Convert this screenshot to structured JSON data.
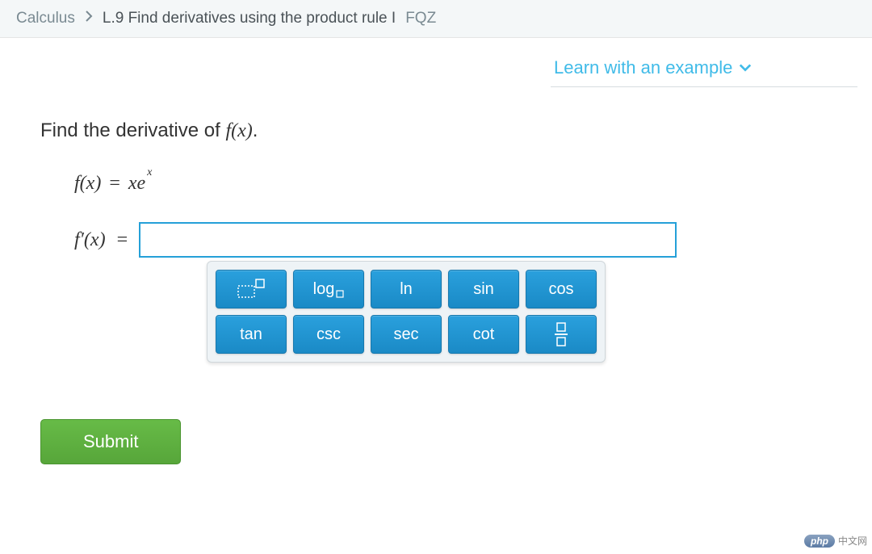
{
  "breadcrumb": {
    "subject": "Calculus",
    "lesson": "L.9 Find derivatives using the product rule I",
    "code": "FQZ"
  },
  "learn": {
    "label": "Learn with an example"
  },
  "question": {
    "prompt_prefix": "Find the derivative of ",
    "prompt_fx": "f(x)",
    "prompt_suffix": ".",
    "given_lhs": "f(x)",
    "equals": "=",
    "given_rhs_base": "xe",
    "given_rhs_exp": "x",
    "answer_lhs": "f′(x)",
    "answer_value": ""
  },
  "keypad": {
    "buttons": [
      {
        "id": "exponent",
        "kind": "icon"
      },
      {
        "id": "log",
        "label": "log"
      },
      {
        "id": "ln",
        "label": "ln"
      },
      {
        "id": "sin",
        "label": "sin"
      },
      {
        "id": "cos",
        "label": "cos"
      },
      {
        "id": "tan",
        "label": "tan"
      },
      {
        "id": "csc",
        "label": "csc"
      },
      {
        "id": "sec",
        "label": "sec"
      },
      {
        "id": "cot",
        "label": "cot"
      },
      {
        "id": "fraction",
        "kind": "icon"
      }
    ]
  },
  "submit": {
    "label": "Submit"
  },
  "watermark": {
    "brand": "php",
    "text": "中文网"
  }
}
